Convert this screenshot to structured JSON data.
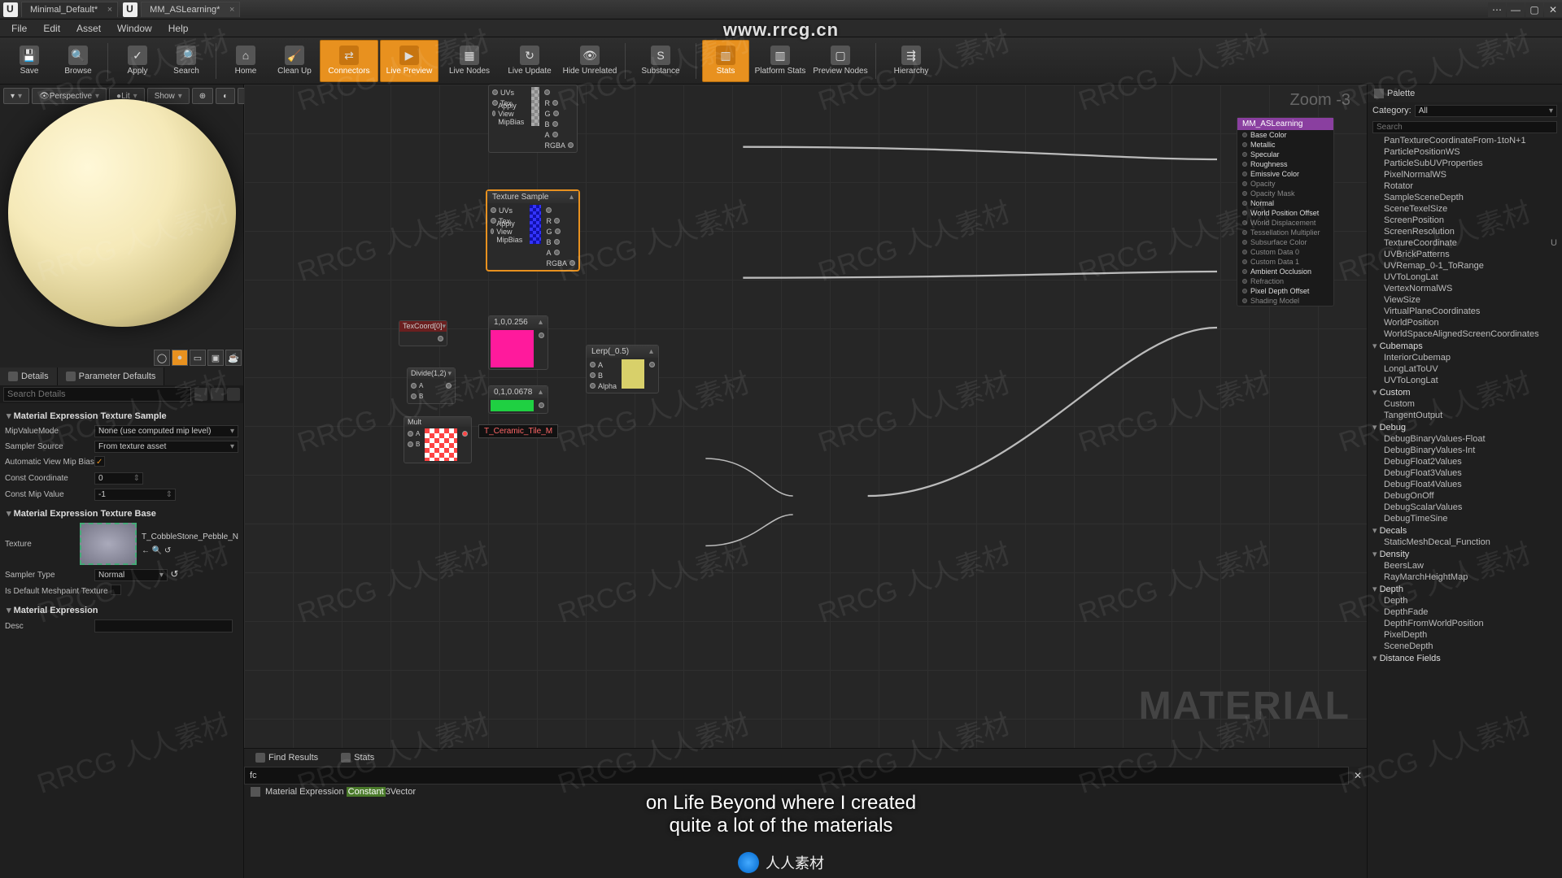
{
  "titlebar": {
    "tabs": [
      "Minimal_Default*",
      "MM_ASLearning*"
    ]
  },
  "menubar": [
    "File",
    "Edit",
    "Asset",
    "Window",
    "Help"
  ],
  "url_watermark": "www.rrcg.cn",
  "toolbar": {
    "save": "Save",
    "browse": "Browse",
    "apply": "Apply",
    "search": "Search",
    "home": "Home",
    "cleanup": "Clean Up",
    "connectors": "Connectors",
    "livepreview": "Live Preview",
    "livenodes": "Live Nodes",
    "liveupdate": "Live Update",
    "hideunrelated": "Hide Unrelated",
    "substance": "Substance",
    "stats": "Stats",
    "platformstats": "Platform Stats",
    "previewnodes": "Preview Nodes",
    "hierarchy": "Hierarchy"
  },
  "preview": {
    "perspective": "Perspective",
    "lit": "Lit",
    "show": "Show"
  },
  "details": {
    "tab1": "Details",
    "tab2": "Parameter Defaults",
    "search_ph": "Search Details",
    "sect1": "Material Expression Texture Sample",
    "mipvaluemode_k": "MipValueMode",
    "mipvaluemode_v": "None (use computed mip level)",
    "samplersource_k": "Sampler Source",
    "samplersource_v": "From texture asset",
    "autoviewmip_k": "Automatic View Mip Bias",
    "constcoord_k": "Const Coordinate",
    "constcoord_v": "0",
    "constmip_k": "Const Mip Value",
    "constmip_v": "-1",
    "sect2": "Material Expression Texture Base",
    "texture_k": "Texture",
    "texture_name": "T_CobbleStone_Pebble_N",
    "samplertype_k": "Sampler Type",
    "samplertype_v": "Normal",
    "isdefault_k": "Is Default Meshpaint Texture",
    "sect3": "Material Expression",
    "desc_k": "Desc"
  },
  "graph": {
    "zoom": "Zoom -3",
    "material_wm": "MATERIAL",
    "texsample": "Texture Sample",
    "texsample_pins_l": [
      "UVs",
      "Tex",
      "Apply View MipBias"
    ],
    "texsample_pins_r": [
      "",
      "R",
      "G",
      "B",
      "A",
      "RGBA"
    ],
    "texcoord": "TexCoord[0]",
    "divide": "Divide(1,2)",
    "divide_pins": [
      "A",
      "B"
    ],
    "const_pink": "1,0,0.256",
    "const_green": "0,1,0.0678",
    "lerp": "Lerp(_0.5)",
    "lerp_pins": [
      "A",
      "B",
      "Alpha"
    ],
    "mult": "Mult",
    "tooltip": "T_Ceramic_Tile_M",
    "outnode": {
      "title": "MM_ASLearning",
      "pins": [
        "Base Color",
        "Metallic",
        "Specular",
        "Roughness",
        "Emissive Color",
        "Opacity",
        "Opacity Mask",
        "Normal",
        "World Position Offset",
        "World Displacement",
        "Tessellation Multiplier",
        "Subsurface Color",
        "Custom Data 0",
        "Custom Data 1",
        "Ambient Occlusion",
        "Refraction",
        "Pixel Depth Offset",
        "Shading Model"
      ],
      "active": [
        0,
        1,
        2,
        3,
        4,
        7,
        8,
        14,
        16
      ]
    }
  },
  "bottom": {
    "tab1": "Find Results",
    "tab2": "Stats",
    "search_val": "fc",
    "row_pre": "Material Expression ",
    "row_hl": "Constant",
    "row_post": "3Vector"
  },
  "palette": {
    "title": "Palette",
    "category_k": "Category:",
    "category_v": "All",
    "search_ph": "Search",
    "items_flat": [
      "PanTextureCoordinateFrom-1toN+1",
      "ParticlePositionWS",
      "ParticleSubUVProperties",
      "PixelNormalWS",
      "Rotator",
      "SampleSceneDepth",
      "SceneTexelSize",
      "ScreenPosition",
      "ScreenResolution"
    ],
    "texcoord_item": "TextureCoordinate",
    "texcoord_sc": "U",
    "items_flat2": [
      "UVBrickPatterns",
      "UVRemap_0-1_ToRange",
      "UVToLongLat",
      "VertexNormalWS",
      "ViewSize",
      "VirtualPlaneCoordinates",
      "WorldPosition",
      "WorldSpaceAlignedScreenCoordinates"
    ],
    "cat_cubemaps": "Cubemaps",
    "cubemaps": [
      "InteriorCubemap",
      "LongLatToUV",
      "UVToLongLat"
    ],
    "cat_custom": "Custom",
    "custom": [
      "Custom",
      "TangentOutput"
    ],
    "cat_debug": "Debug",
    "debug": [
      "DebugBinaryValues-Float",
      "DebugBinaryValues-Int",
      "DebugFloat2Values",
      "DebugFloat3Values",
      "DebugFloat4Values",
      "DebugOnOff",
      "DebugScalarValues",
      "DebugTimeSine"
    ],
    "cat_decals": "Decals",
    "decals": [
      "StaticMeshDecal_Function"
    ],
    "cat_density": "Density",
    "density": [
      "BeersLaw",
      "RayMarchHeightMap"
    ],
    "cat_depth": "Depth",
    "depth": [
      "Depth",
      "DepthFade",
      "DepthFromWorldPosition",
      "PixelDepth",
      "SceneDepth"
    ],
    "cat_distance": "Distance Fields"
  },
  "subtitle": {
    "l1": "on Life Beyond where I created",
    "l2": "quite a lot of the materials"
  },
  "footer": "人人素材"
}
